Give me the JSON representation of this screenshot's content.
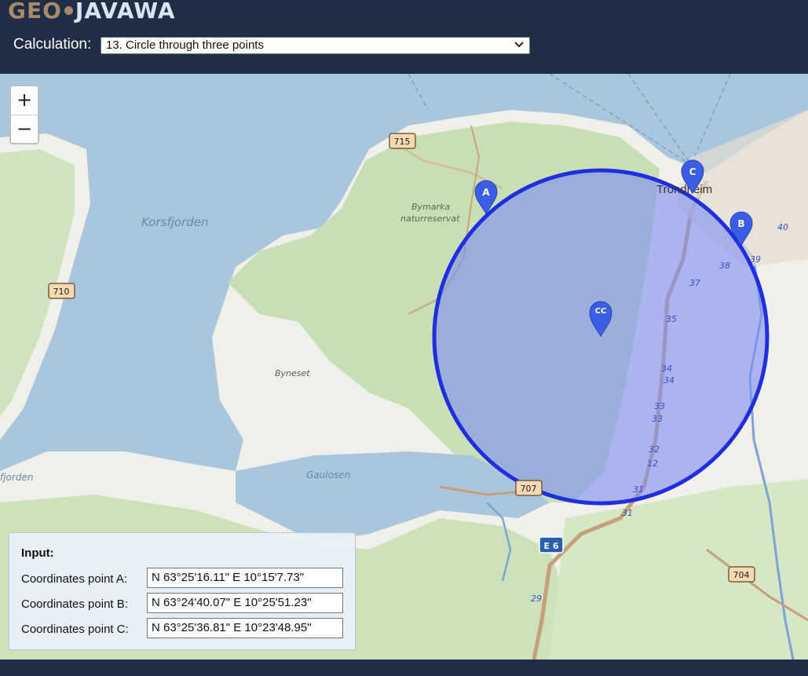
{
  "logo": {
    "part1": "GEO",
    "part2": "JAVAWA"
  },
  "calculation": {
    "label": "Calculation:",
    "selected": "13. Circle through three points"
  },
  "zoom": {
    "in": "+",
    "out": "−"
  },
  "map": {
    "labels": {
      "korsfjorden": "Korsfjorden",
      "bymarka": "Bymarka",
      "naturreservat": "naturreservat",
      "byneset": "Byneset",
      "gaulosen": "Gaulosen",
      "fjorden": "fjorden",
      "trondheim": "Trondheim"
    },
    "road_shields": {
      "r715": "715",
      "r710": "710",
      "r707": "707",
      "r704": "704",
      "e6": "E 6"
    },
    "road_numbers": [
      "40",
      "39",
      "38",
      "37",
      "35",
      "34",
      "34",
      "33",
      "33",
      "32",
      "12",
      "31",
      "31",
      "29"
    ],
    "markers": {
      "a": "A",
      "b": "B",
      "c": "C",
      "cc": "CC"
    },
    "colors": {
      "water": "#a9c6dc",
      "land": "#f1efe9",
      "forest": "#c8dfb6",
      "circle_stroke": "#1f2ee0",
      "circle_fill": "#7f8ff0",
      "marker": "#3b5ee6"
    }
  },
  "input": {
    "title": "Input:",
    "rows": [
      {
        "label": "Coordinates point A:",
        "value": "N 63°25'16.11\" E 10°15'7.73\""
      },
      {
        "label": "Coordinates point B:",
        "value": "N 63°24'40.07\" E 10°25'51.23\""
      },
      {
        "label": "Coordinates point C:",
        "value": "N 63°25'36.81\" E 10°23'48.95\""
      }
    ]
  }
}
